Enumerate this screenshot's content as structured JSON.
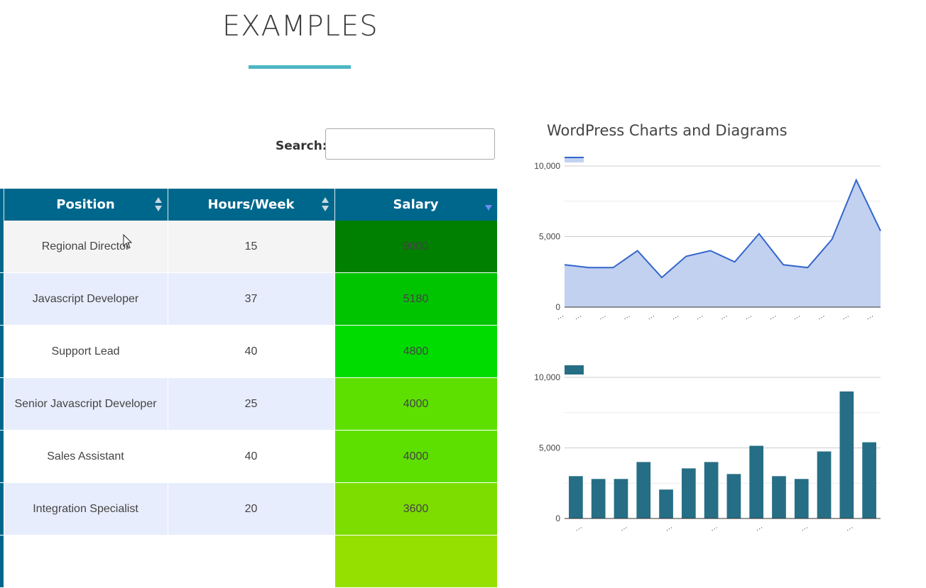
{
  "page": {
    "heading": "EXAMPLES",
    "accent_color": "#4db6c3"
  },
  "search": {
    "label": "Search:",
    "value": "",
    "placeholder": ""
  },
  "table": {
    "header_color": "#00678c",
    "columns": [
      {
        "label": "Position",
        "sort": "both"
      },
      {
        "label": "Hours/Week",
        "sort": "both"
      },
      {
        "label": "Salary",
        "sort": "descending"
      }
    ],
    "rows": [
      {
        "position": "Regional Director",
        "hours": "15",
        "salary": "9000",
        "salary_color": "#008000"
      },
      {
        "position": "Javascript Developer",
        "hours": "37",
        "salary": "5180",
        "salary_color": "#00c400"
      },
      {
        "position": "Support Lead",
        "hours": "40",
        "salary": "4800",
        "salary_color": "#00dc00"
      },
      {
        "position": "Senior Javascript Developer",
        "hours": "25",
        "salary": "4000",
        "salary_color": "#5de000"
      },
      {
        "position": "Sales Assistant",
        "hours": "40",
        "salary": "4000",
        "salary_color": "#5de000"
      },
      {
        "position": "Integration Specialist",
        "hours": "20",
        "salary": "3600",
        "salary_color": "#7ddd00"
      }
    ],
    "partial_row_salary_color": "#96e000"
  },
  "chart_title": "WordPress Charts and Diagrams",
  "chart_data": [
    {
      "type": "area",
      "ylim": [
        0,
        10000
      ],
      "ytick_labels": [
        "0",
        "5,000",
        "10,000"
      ],
      "xtick_label": "…",
      "color": "#3366cc",
      "fill": "#c2d1f0",
      "values": [
        3000,
        2800,
        2800,
        4000,
        2100,
        3600,
        4000,
        3200,
        5200,
        3000,
        2800,
        4800,
        9000,
        5400
      ]
    },
    {
      "type": "bar",
      "ylim": [
        0,
        10000
      ],
      "ytick_labels": [
        "0",
        "5,000",
        "10,000"
      ],
      "xtick_label": "…",
      "color": "#266e85",
      "values": [
        3000,
        2800,
        2800,
        4000,
        2050,
        3550,
        4000,
        3150,
        5150,
        3000,
        2800,
        4750,
        9000,
        5400
      ]
    }
  ]
}
